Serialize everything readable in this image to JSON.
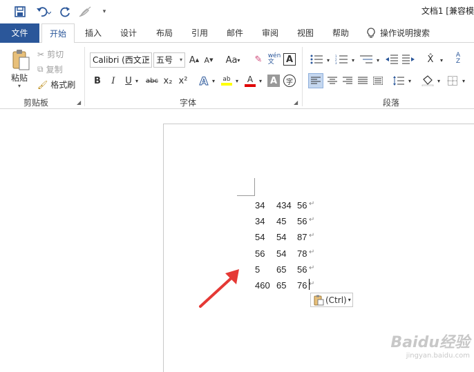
{
  "titlebar": {
    "save_icon": "save-icon",
    "undo_icon": "undo-icon",
    "redo_icon": "redo-icon",
    "format_icon": "format-painter-icon",
    "doc_title": "文档1 [兼容模"
  },
  "tabs": [
    "文件",
    "开始",
    "插入",
    "设计",
    "布局",
    "引用",
    "邮件",
    "审阅",
    "视图",
    "帮助"
  ],
  "tell_me": "操作说明搜索",
  "clipboard": {
    "paste": "粘贴",
    "cut": "剪切",
    "copy": "复制",
    "format_painter": "格式刷",
    "label": "剪贴板"
  },
  "font": {
    "name": "Calibri (西文正",
    "size": "五号",
    "grow": "A",
    "shrink": "A",
    "case": "Aa",
    "bold": "B",
    "italic": "I",
    "underline": "U",
    "strike": "abc",
    "subscript": "x₂",
    "superscript": "x²",
    "label": "字体"
  },
  "paragraph": {
    "label": "段落"
  },
  "document": {
    "rows": [
      [
        "34",
        "434",
        "56"
      ],
      [
        "34",
        "45",
        "56"
      ],
      [
        "54",
        "54",
        "87"
      ],
      [
        "56",
        "54",
        "78"
      ],
      [
        "5",
        "65",
        "56"
      ],
      [
        "460",
        "65",
        "76"
      ]
    ],
    "para_mark": "↵"
  },
  "paste_options": {
    "label": "(Ctrl)"
  },
  "watermark": {
    "brand": "Baidu经验",
    "url": "jingyan.baidu.com"
  },
  "colors": {
    "brand_blue": "#2b579a",
    "arrow_red": "#e53935"
  }
}
